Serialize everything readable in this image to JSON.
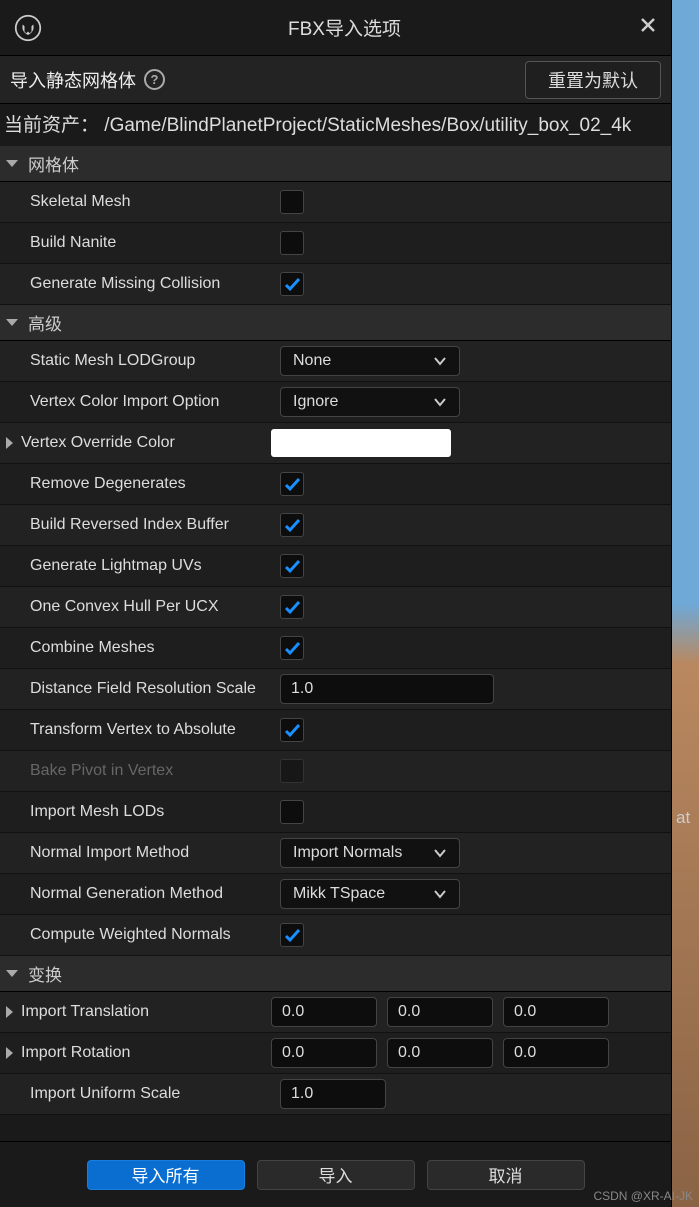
{
  "title": "FBX导入选项",
  "subheader": "导入静态网格体",
  "reset_btn": "重置为默认",
  "asset_prefix": "当前资产：",
  "asset_path": "/Game/BlindPlanetProject/StaticMeshes/Box/utility_box_02_4k",
  "sections": {
    "mesh": "网格体",
    "advanced": "高级",
    "transform": "变换"
  },
  "rows": {
    "skeletal_mesh": {
      "label": "Skeletal Mesh",
      "checked": false
    },
    "build_nanite": {
      "label": "Build Nanite",
      "checked": false
    },
    "gen_missing_collision": {
      "label": "Generate Missing Collision",
      "checked": true
    },
    "lod_group": {
      "label": "Static Mesh LODGroup",
      "value": "None"
    },
    "vertex_color_import": {
      "label": "Vertex Color Import Option",
      "value": "Ignore"
    },
    "vertex_override_color": {
      "label": "Vertex Override Color",
      "color": "#FFFFFF"
    },
    "remove_degenerates": {
      "label": "Remove Degenerates",
      "checked": true
    },
    "build_reversed": {
      "label": "Build Reversed Index Buffer",
      "checked": true
    },
    "gen_lightmap_uvs": {
      "label": "Generate Lightmap UVs",
      "checked": true
    },
    "one_convex_hull": {
      "label": "One Convex Hull Per UCX",
      "checked": true
    },
    "combine_meshes": {
      "label": "Combine Meshes",
      "checked": true
    },
    "dist_field_res": {
      "label": "Distance Field Resolution Scale",
      "value": "1.0"
    },
    "transform_vertex_abs": {
      "label": "Transform Vertex to Absolute",
      "checked": true
    },
    "bake_pivot": {
      "label": "Bake Pivot in Vertex",
      "checked": false,
      "disabled": true
    },
    "import_mesh_lods": {
      "label": "Import Mesh LODs",
      "checked": false
    },
    "normal_import": {
      "label": "Normal Import Method",
      "value": "Import Normals"
    },
    "normal_gen": {
      "label": "Normal Generation Method",
      "value": "Mikk TSpace"
    },
    "compute_weighted": {
      "label": "Compute Weighted Normals",
      "checked": true
    },
    "import_translation": {
      "label": "Import Translation",
      "x": "0.0",
      "y": "0.0",
      "z": "0.0"
    },
    "import_rotation": {
      "label": "Import Rotation",
      "x": "0.0",
      "y": "0.0",
      "z": "0.0"
    },
    "import_uniform_scale": {
      "label": "Import Uniform Scale",
      "value": "1.0"
    }
  },
  "footer": {
    "import_all": "导入所有",
    "import": "导入",
    "cancel": "取消"
  },
  "side_text": "at",
  "watermark": "CSDN @XR-AI-JK"
}
